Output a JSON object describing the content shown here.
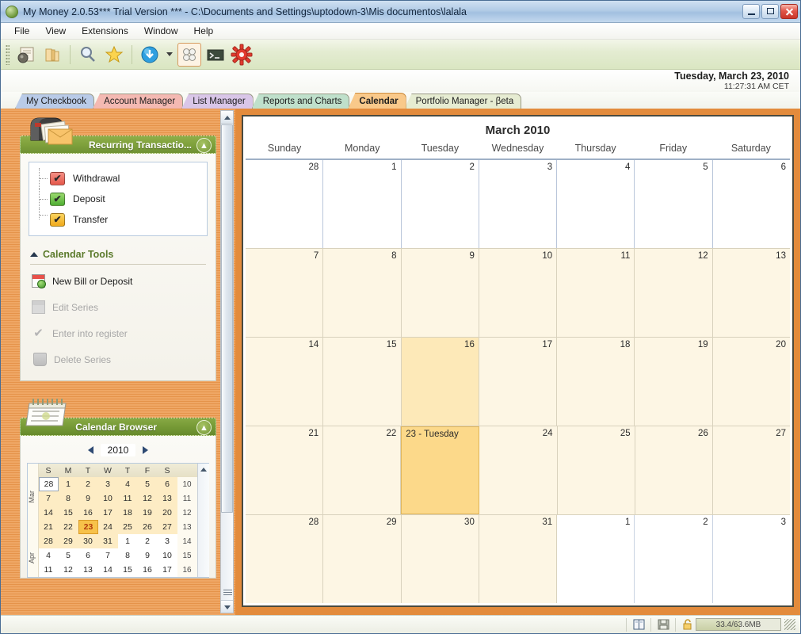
{
  "window": {
    "title": "My Money 2.0.53*** Trial Version *** - C:\\Documents and Settings\\uptodown-3\\Mis documentos\\lalala",
    "app_icon": "app-globe-icon",
    "minimize_label": "Minimize",
    "maximize_label": "Maximize",
    "close_label": "Close"
  },
  "menu": {
    "items": [
      {
        "label": "File"
      },
      {
        "label": "View"
      },
      {
        "label": "Extensions"
      },
      {
        "label": "Window"
      },
      {
        "label": "Help"
      }
    ]
  },
  "toolbar": {
    "buttons": [
      {
        "name": "new-document-icon",
        "glyph": "🗞"
      },
      {
        "name": "open-folder-icon",
        "glyph": "📁"
      },
      {
        "name": "search-icon",
        "glyph": "🔍"
      },
      {
        "name": "favorites-star-icon",
        "glyph": "★"
      },
      {
        "name": "download-icon",
        "glyph": "↓"
      },
      {
        "name": "grid-view-icon",
        "glyph": "∷"
      },
      {
        "name": "console-icon",
        "glyph": "❯_"
      },
      {
        "name": "settings-gear-icon",
        "glyph": "⚙"
      }
    ]
  },
  "datestrip": {
    "date": "Tuesday, March 23, 2010",
    "time": "11:27:31 AM CET"
  },
  "tabs": {
    "items": [
      {
        "label": "My Checkbook",
        "color": "#b9cbe8",
        "active": false
      },
      {
        "label": "Account Manager",
        "color": "#f4b9b2",
        "active": false
      },
      {
        "label": "List Manager",
        "color": "#d9c6e8",
        "active": false
      },
      {
        "label": "Reports and Charts",
        "color": "#bfe0cb",
        "active": false
      },
      {
        "label": "Calendar",
        "color": "#f9c98a",
        "active": true
      },
      {
        "label": "Portfolio Manager - βeta",
        "color": "#dfe7c5",
        "active": false
      }
    ]
  },
  "sidebar": {
    "recurring_panel": {
      "title": "Recurring Transactio...",
      "header_icon": "mailbox-icon",
      "collapse_icon": "chevron-up-icon",
      "items": [
        {
          "label": "Withdrawal",
          "color": "red",
          "checked": true
        },
        {
          "label": "Deposit",
          "color": "green",
          "checked": true
        },
        {
          "label": "Transfer",
          "color": "yellow",
          "checked": true
        }
      ]
    },
    "calendar_tools": {
      "title": "Calendar Tools",
      "items": [
        {
          "label": "New Bill or Deposit",
          "icon": "new-bill-icon",
          "disabled": false
        },
        {
          "label": "Edit Series",
          "icon": "edit-series-icon",
          "disabled": true
        },
        {
          "label": "Enter into register",
          "icon": "check-icon",
          "disabled": true
        },
        {
          "label": "Delete Series",
          "icon": "trash-icon",
          "disabled": true
        }
      ]
    },
    "calendar_browser": {
      "title": "Calendar Browser",
      "header_icon": "desk-calendar-icon",
      "collapse_icon": "chevron-up-icon",
      "year": "2010",
      "prev_label": "Previous year",
      "next_label": "Next year",
      "dow": [
        "S",
        "M",
        "T",
        "W",
        "T",
        "F",
        "S"
      ],
      "rows": [
        {
          "month": "Mar",
          "days": [
            {
              "d": "28",
              "state": "boxsel"
            },
            {
              "d": "1",
              "state": "inmonth"
            },
            {
              "d": "2",
              "state": "inmonth"
            },
            {
              "d": "3",
              "state": "inmonth"
            },
            {
              "d": "4",
              "state": "inmonth"
            },
            {
              "d": "5",
              "state": "inmonth"
            },
            {
              "d": "6",
              "state": "inmonth"
            }
          ],
          "week": "10"
        },
        {
          "month": "",
          "days": [
            {
              "d": "7",
              "state": "inmonth"
            },
            {
              "d": "8",
              "state": "inmonth"
            },
            {
              "d": "9",
              "state": "inmonth"
            },
            {
              "d": "10",
              "state": "inmonth"
            },
            {
              "d": "11",
              "state": "inmonth"
            },
            {
              "d": "12",
              "state": "inmonth"
            },
            {
              "d": "13",
              "state": "inmonth"
            }
          ],
          "week": "11"
        },
        {
          "month": "Mar",
          "days": [
            {
              "d": "14",
              "state": "inmonth"
            },
            {
              "d": "15",
              "state": "inmonth"
            },
            {
              "d": "16",
              "state": "inmonth"
            },
            {
              "d": "17",
              "state": "inmonth"
            },
            {
              "d": "18",
              "state": "inmonth"
            },
            {
              "d": "19",
              "state": "inmonth"
            },
            {
              "d": "20",
              "state": "inmonth"
            }
          ],
          "week": "12"
        },
        {
          "month": "",
          "days": [
            {
              "d": "21",
              "state": "inmonth"
            },
            {
              "d": "22",
              "state": "inmonth"
            },
            {
              "d": "23",
              "state": "today"
            },
            {
              "d": "24",
              "state": "inmonth"
            },
            {
              "d": "25",
              "state": "inmonth"
            },
            {
              "d": "26",
              "state": "inmonth"
            },
            {
              "d": "27",
              "state": "inmonth"
            }
          ],
          "week": "13"
        },
        {
          "month": "",
          "days": [
            {
              "d": "28",
              "state": "inmonth"
            },
            {
              "d": "29",
              "state": "inmonth"
            },
            {
              "d": "30",
              "state": "inmonth"
            },
            {
              "d": "31",
              "state": "inmonth"
            },
            {
              "d": "1",
              "state": "outmonth"
            },
            {
              "d": "2",
              "state": "outmonth"
            },
            {
              "d": "3",
              "state": "outmonth"
            }
          ],
          "week": "14"
        },
        {
          "month": "",
          "days": [
            {
              "d": "4",
              "state": "outmonth"
            },
            {
              "d": "5",
              "state": "outmonth"
            },
            {
              "d": "6",
              "state": "outmonth"
            },
            {
              "d": "7",
              "state": "outmonth"
            },
            {
              "d": "8",
              "state": "outmonth"
            },
            {
              "d": "9",
              "state": "outmonth"
            },
            {
              "d": "10",
              "state": "outmonth"
            }
          ],
          "week": "15"
        },
        {
          "month": "Apr",
          "days": [
            {
              "d": "11",
              "state": "outmonth"
            },
            {
              "d": "12",
              "state": "outmonth"
            },
            {
              "d": "13",
              "state": "outmonth"
            },
            {
              "d": "14",
              "state": "outmonth"
            },
            {
              "d": "15",
              "state": "outmonth"
            },
            {
              "d": "16",
              "state": "outmonth"
            },
            {
              "d": "17",
              "state": "outmonth"
            }
          ],
          "week": "16"
        }
      ]
    }
  },
  "calendar": {
    "title": "March 2010",
    "dow": [
      "Sunday",
      "Monday",
      "Tuesday",
      "Wednesday",
      "Thursday",
      "Friday",
      "Saturday"
    ],
    "weeks": [
      [
        {
          "n": "28",
          "state": "other"
        },
        {
          "n": "1",
          "state": "other"
        },
        {
          "n": "2",
          "state": "other"
        },
        {
          "n": "3",
          "state": "other"
        },
        {
          "n": "4",
          "state": "other"
        },
        {
          "n": "5",
          "state": "other"
        },
        {
          "n": "6",
          "state": "other"
        }
      ],
      [
        {
          "n": "7",
          "state": "month"
        },
        {
          "n": "8",
          "state": "month"
        },
        {
          "n": "9",
          "state": "month"
        },
        {
          "n": "10",
          "state": "month"
        },
        {
          "n": "11",
          "state": "month"
        },
        {
          "n": "12",
          "state": "month"
        },
        {
          "n": "13",
          "state": "month"
        }
      ],
      [
        {
          "n": "14",
          "state": "month"
        },
        {
          "n": "15",
          "state": "month"
        },
        {
          "n": "16",
          "state": "hilite"
        },
        {
          "n": "17",
          "state": "month"
        },
        {
          "n": "18",
          "state": "month"
        },
        {
          "n": "19",
          "state": "month"
        },
        {
          "n": "20",
          "state": "month"
        }
      ],
      [
        {
          "n": "21",
          "state": "month"
        },
        {
          "n": "22",
          "state": "month"
        },
        {
          "n": "23 - Tuesday",
          "state": "selected"
        },
        {
          "n": "24",
          "state": "month"
        },
        {
          "n": "25",
          "state": "month"
        },
        {
          "n": "26",
          "state": "month"
        },
        {
          "n": "27",
          "state": "month"
        }
      ],
      [
        {
          "n": "28",
          "state": "month"
        },
        {
          "n": "29",
          "state": "month"
        },
        {
          "n": "30",
          "state": "month"
        },
        {
          "n": "31",
          "state": "month"
        },
        {
          "n": "1",
          "state": "other"
        },
        {
          "n": "2",
          "state": "other"
        },
        {
          "n": "3",
          "state": "other"
        }
      ]
    ]
  },
  "statusbar": {
    "icons": [
      {
        "name": "book-icon",
        "glyph": "📖"
      },
      {
        "name": "save-icon",
        "glyph": "💾"
      },
      {
        "name": "lock-icon",
        "glyph": "🔓"
      }
    ],
    "memory": "33.4/63.6MB",
    "memory_percent": 52
  }
}
